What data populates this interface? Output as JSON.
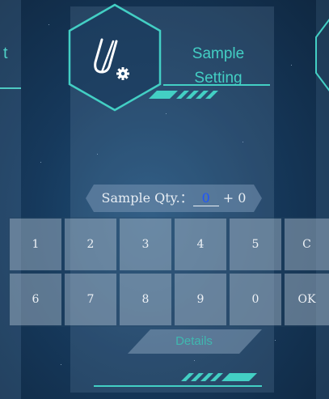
{
  "header": {
    "title_line1": "Sample",
    "title_line2": "Setting",
    "icon": "sample-setting-icon"
  },
  "left_panel": {
    "partial_label": "t"
  },
  "quantity": {
    "label": "Sample Qty.：",
    "value": "0",
    "suffix": "+ 0"
  },
  "keypad": {
    "row1": [
      "1",
      "2",
      "3",
      "4",
      "5",
      "C"
    ],
    "row2": [
      "6",
      "7",
      "8",
      "9",
      "0",
      "OK"
    ]
  },
  "details": {
    "label": "Details"
  },
  "colors": {
    "accent": "#43cfc4",
    "value": "#1e54ff",
    "background": "#16395c"
  }
}
